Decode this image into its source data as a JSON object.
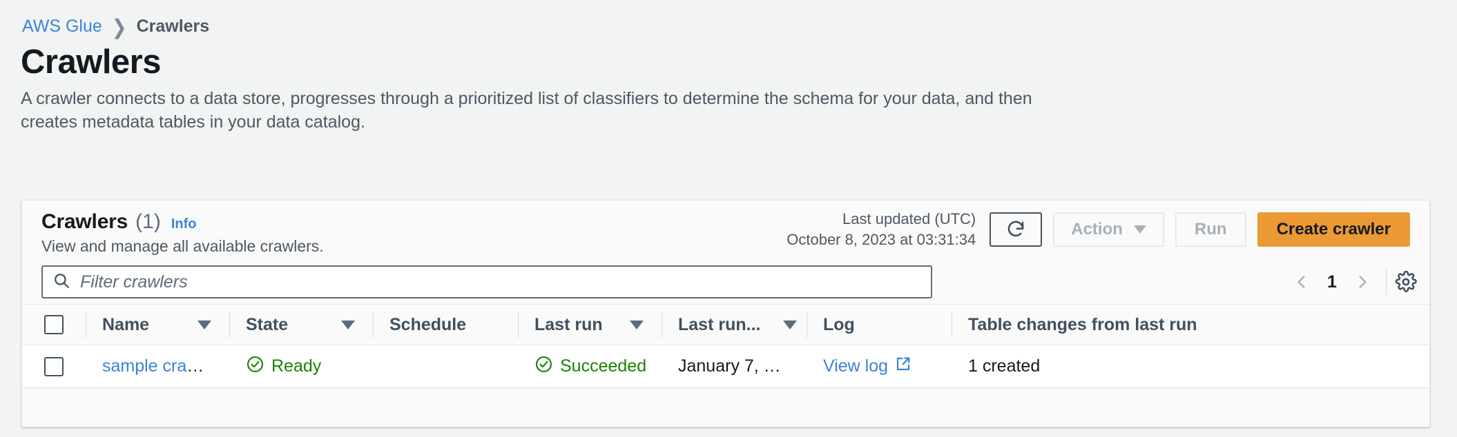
{
  "breadcrumb": {
    "root": "AWS Glue",
    "separator_icon": "chevron-right-icon",
    "current": "Crawlers"
  },
  "page": {
    "title": "Crawlers",
    "description": "A crawler connects to a data store, progresses through a prioritized list of classifiers to determine the schema for your data, and then creates metadata tables in your data catalog."
  },
  "card": {
    "header": {
      "title": "Crawlers",
      "count": "(1)",
      "info_label": "Info",
      "subtitle": "View and manage all available crawlers.",
      "last_updated_label": "Last updated (UTC)",
      "last_updated_value": "October 8, 2023 at 03:31:34",
      "refresh_icon": "refresh-icon",
      "action_label": "Action",
      "action_caret_icon": "caret-down-icon",
      "run_label": "Run",
      "create_label": "Create crawler"
    },
    "filter": {
      "search_icon": "search-icon",
      "placeholder": "Filter crawlers",
      "value": ""
    },
    "pagination": {
      "prev_icon": "chevron-left-icon",
      "current_page": "1",
      "next_icon": "chevron-right-icon",
      "settings_icon": "gear-icon"
    }
  },
  "table": {
    "select_all_icon": "checkbox-unchecked-icon",
    "columns": [
      {
        "label": "Name",
        "sortable": true
      },
      {
        "label": "State",
        "sortable": true
      },
      {
        "label": "Schedule",
        "sortable": false
      },
      {
        "label": "Last run",
        "sortable": true
      },
      {
        "label": "Last run...",
        "sortable": true
      },
      {
        "label": "Log",
        "sortable": false
      },
      {
        "label": "Table changes from last run",
        "sortable": false
      }
    ],
    "sort_icon": "caret-down-icon",
    "rows": [
      {
        "select_icon": "checkbox-unchecked-icon",
        "name": "sample cra",
        "name_ellipsis": "…",
        "state": "Ready",
        "state_icon": "status-success-icon",
        "schedule": "",
        "last_run": "Succeeded",
        "last_run_icon": "status-success-icon",
        "last_run_time": "January 7, …",
        "log": "View log",
        "log_icon": "external-link-icon",
        "table_changes": "1 created"
      }
    ]
  },
  "colors": {
    "link": "#3d83d6",
    "accent": "#eb9a35",
    "success": "#1d8102",
    "text": "#16191f",
    "muted": "#4d5862",
    "page_bg": "#f2f3f3",
    "card_bg": "#fafafa",
    "row_bg": "#ffffff"
  }
}
